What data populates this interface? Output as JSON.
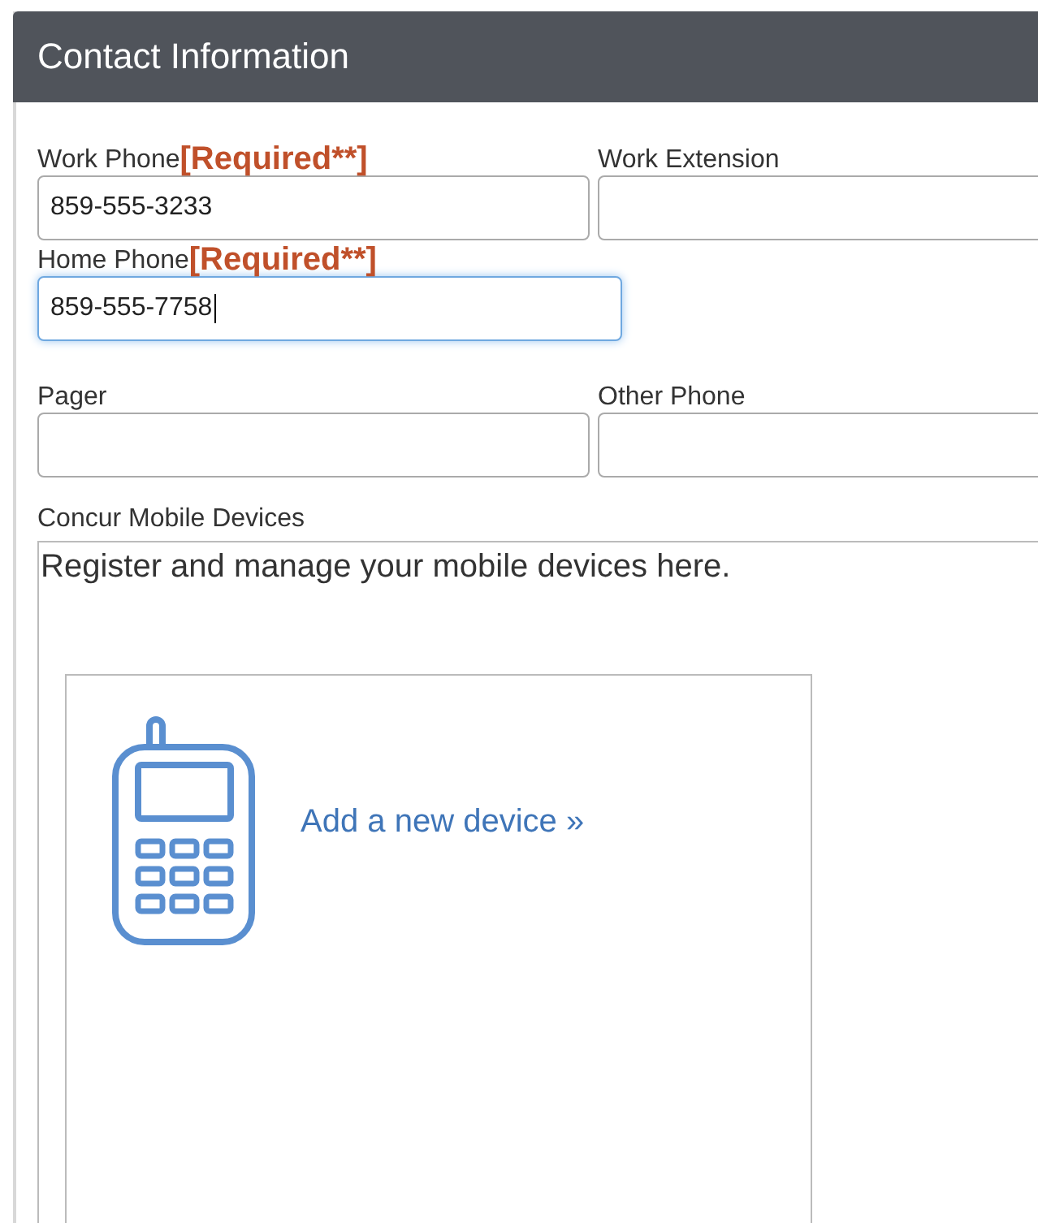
{
  "panel": {
    "title": "Contact Information"
  },
  "field_rows": [
    [
      {
        "label": "Work Phone",
        "required": "[Required**]",
        "value": "859-555-3233",
        "focused": false
      },
      {
        "label": "Work Extension",
        "focused": false
      }
    ],
    [
      {
        "label": "Home Phone",
        "required": "[Required**]",
        "value": "859-555-7758",
        "focused": true
      }
    ],
    [
      {
        "label": "Pager",
        "focused": false
      },
      {
        "label": "Other Phone",
        "focused": false
      }
    ]
  ],
  "mobile_devices": {
    "label": "Concur Mobile Devices",
    "intro": "Register and manage your mobile devices here.",
    "add_link": "Add a new device »"
  }
}
